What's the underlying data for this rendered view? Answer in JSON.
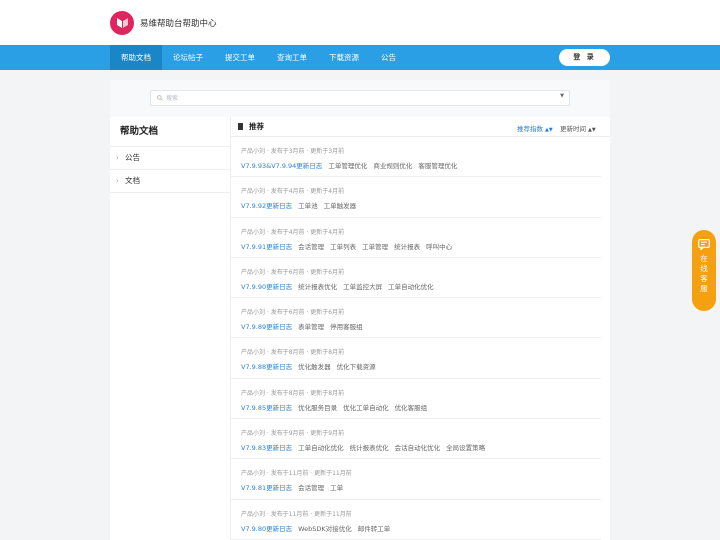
{
  "header": {
    "title": "易维帮助台帮助中心",
    "logo_color": "#e0245e"
  },
  "nav": {
    "items": [
      {
        "label": "帮助文档",
        "active": true
      },
      {
        "label": "论坛帖子",
        "active": false
      },
      {
        "label": "提交工单",
        "active": false
      },
      {
        "label": "查询工单",
        "active": false
      },
      {
        "label": "下载资源",
        "active": false
      },
      {
        "label": "公告",
        "active": false
      }
    ],
    "login_label": "登 录",
    "bg_color": "#2a9fe6"
  },
  "search": {
    "placeholder": "搜索"
  },
  "sidebar": {
    "title": "帮助文档",
    "items": [
      {
        "label": "公告"
      },
      {
        "label": "文档"
      }
    ]
  },
  "main": {
    "title": "推荐",
    "sort_recommended": "推荐指数",
    "sort_updated": "更新时间",
    "entries": [
      {
        "meta": "产品小刘 · 发布于3月前 · 更新于3月前",
        "title": "V7.9.93&V7.9.94更新日志",
        "tags": [
          "工单管理优化",
          "商业规则优化",
          "客服管理优化"
        ]
      },
      {
        "meta": "产品小刘 · 发布于4月前 · 更新于4月前",
        "title": "V7.9.92更新日志",
        "tags": [
          "工单池",
          "工单触发器"
        ]
      },
      {
        "meta": "产品小刘 · 发布于4月前 · 更新于4月前",
        "title": "V7.9.91更新日志",
        "tags": [
          "会话管理",
          "工单列表",
          "工单管理",
          "统计报表",
          "呼叫中心"
        ]
      },
      {
        "meta": "产品小刘 · 发布于6月前 · 更新于6月前",
        "title": "V7.9.90更新日志",
        "tags": [
          "统计报表优化",
          "工单监控大屏",
          "工单自动化优化"
        ]
      },
      {
        "meta": "产品小刘 · 发布于6月前 · 更新于6月前",
        "title": "V7.9.89更新日志",
        "tags": [
          "表单管理",
          "停用客服组"
        ]
      },
      {
        "meta": "产品小刘 · 发布于8月前 · 更新于8月前",
        "title": "V7.9.88更新日志",
        "tags": [
          "优化触发器",
          "优化下载资源"
        ]
      },
      {
        "meta": "产品小刘 · 发布于8月前 · 更新于8月前",
        "title": "V7.9.85更新日志",
        "tags": [
          "优化服务目录",
          "优化工单自动化",
          "优化客服组"
        ]
      },
      {
        "meta": "产品小刘 · 发布于9月前 · 更新于9月前",
        "title": "V7.9.83更新日志",
        "tags": [
          "工单自动化优化",
          "统计报表优化",
          "会话自动化优化",
          "全局设置策略"
        ]
      },
      {
        "meta": "产品小刘 · 发布于11月前 · 更新于11月前",
        "title": "V7.9.81更新日志",
        "tags": [
          "会话管理",
          "工单"
        ]
      },
      {
        "meta": "产品小刘 · 发布于11月前 · 更新于11月前",
        "title": "V7.9.80更新日志",
        "tags": [
          "WebSDK对接优化",
          "邮件转工单"
        ]
      }
    ]
  },
  "service": {
    "label": "在线客服",
    "color": "#f5a011"
  }
}
